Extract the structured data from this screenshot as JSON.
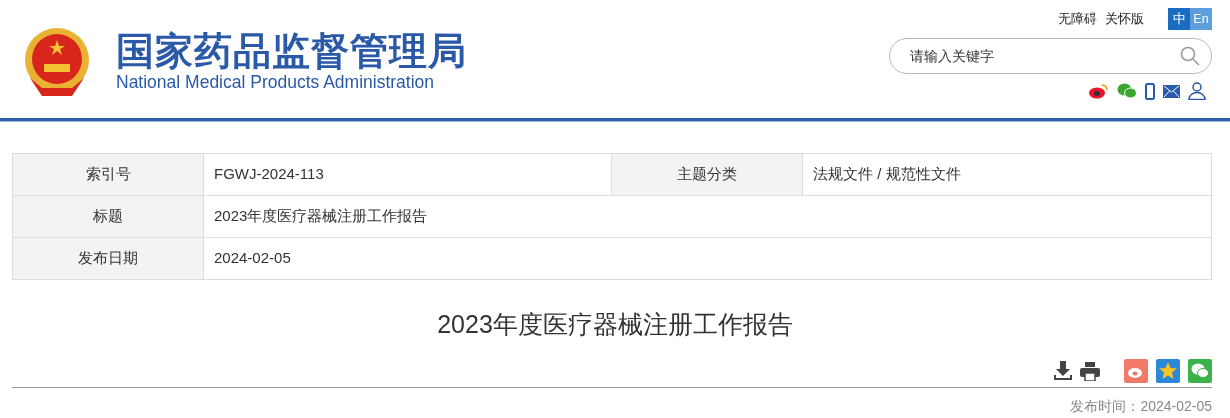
{
  "header": {
    "title_cn": "国家药品监督管理局",
    "title_en": "National Medical Products Administration",
    "links": [
      "无障碍",
      "关怀版"
    ],
    "languages": [
      {
        "label": "中",
        "selected": true
      },
      {
        "label": "En",
        "selected": false
      }
    ],
    "search": {
      "placeholder": "请输入关键字"
    }
  },
  "info_table": {
    "rows": [
      {
        "cells": [
          {
            "label": "索引号",
            "value": "FGWJ-2024-113"
          },
          {
            "label": "主题分类",
            "value": "法规文件 / 规范性文件"
          }
        ]
      },
      {
        "cells": [
          {
            "label": "标题",
            "value": "2023年度医疗器械注册工作报告"
          }
        ]
      },
      {
        "cells": [
          {
            "label": "发布日期",
            "value": "2024-02-05"
          }
        ]
      }
    ]
  },
  "article": {
    "title": "2023年度医疗器械注册工作报告",
    "publish_time": "发布时间：2024-02-05"
  }
}
